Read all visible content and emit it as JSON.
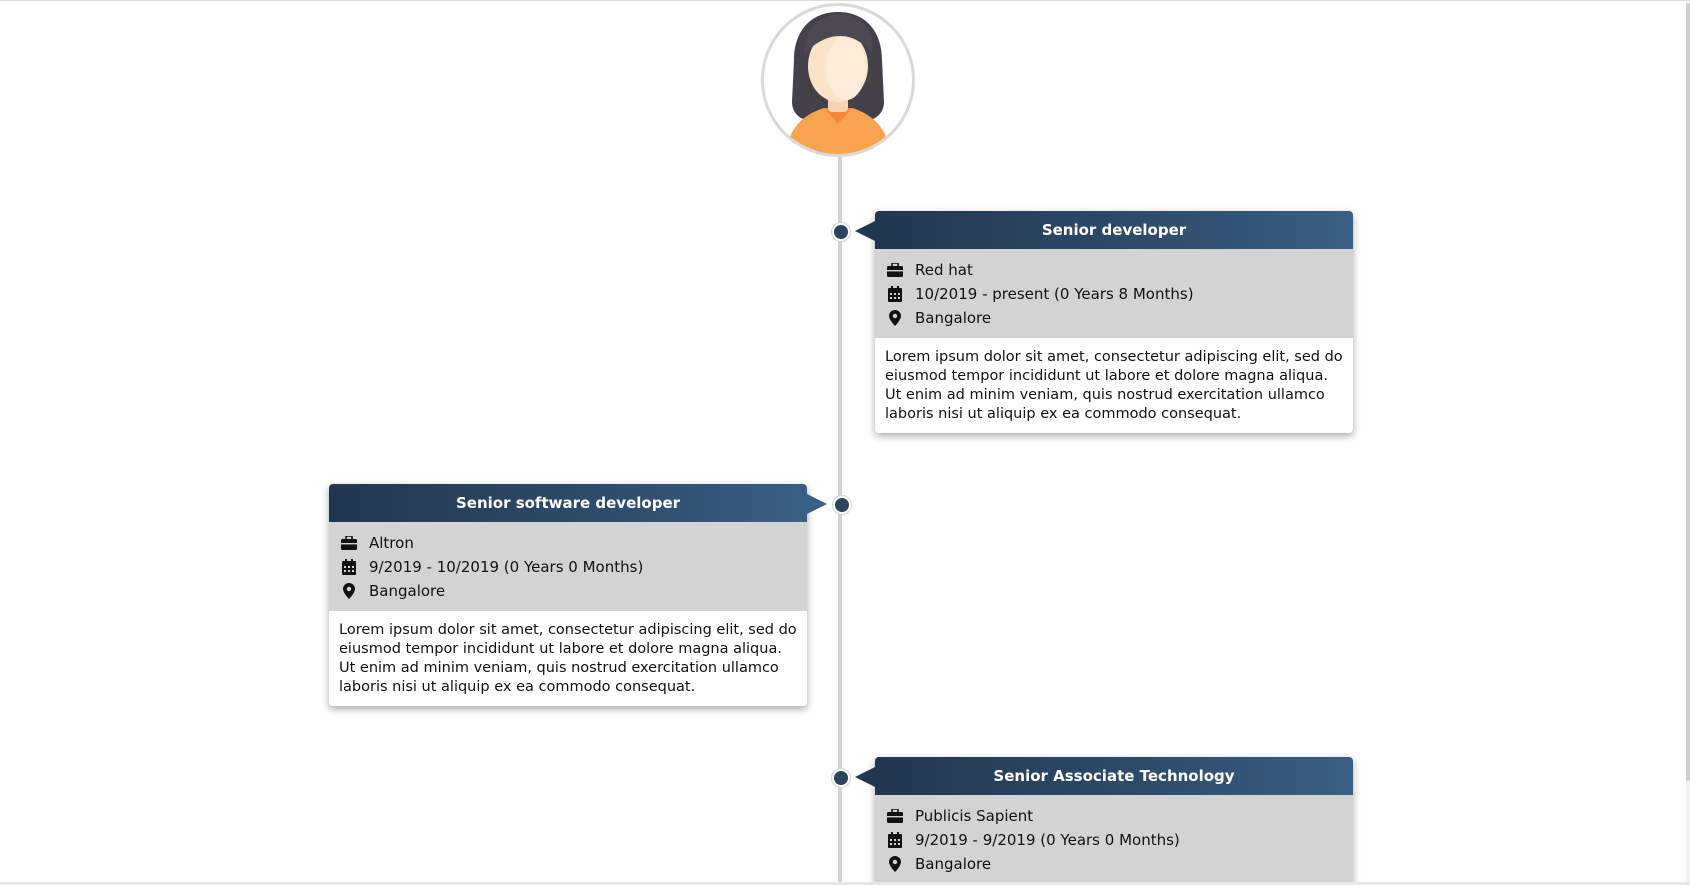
{
  "timeline": {
    "avatar_icon": "woman-avatar-icon",
    "entries": [
      {
        "title": "Senior developer",
        "company": "Red hat",
        "period": "10/2019 - present (0 Years 8 Months)",
        "location": "Bangalore",
        "description": "Lorem ipsum dolor sit amet, consectetur adipiscing elit, sed do eiusmod tempor incididunt ut labore et dolore magna aliqua. Ut enim ad minim veniam, quis nostrud exercitation ullamco laboris nisi ut aliquip ex ea commodo consequat."
      },
      {
        "title": "Senior software developer",
        "company": "Altron",
        "period": "9/2019 - 10/2019 (0 Years 0 Months)",
        "location": "Bangalore",
        "description": "Lorem ipsum dolor sit amet, consectetur adipiscing elit, sed do eiusmod tempor incididunt ut labore et dolore magna aliqua. Ut enim ad minim veniam, quis nostrud exercitation ullamco laboris nisi ut aliquip ex ea commodo consequat."
      },
      {
        "title": "Senior Associate Technology",
        "company": "Publicis Sapient",
        "period": "9/2019 - 9/2019 (0 Years 0 Months)",
        "location": "Bangalore"
      }
    ]
  },
  "icons": {
    "company": "briefcase-icon",
    "period": "calendar-icon",
    "location": "map-pin-icon"
  },
  "colors": {
    "header_dark": "#22364f",
    "header_light": "#3a5f84",
    "meta_bg": "#d3d3d3",
    "timeline_line": "#d3d3d3",
    "dot": "#2b4560"
  }
}
